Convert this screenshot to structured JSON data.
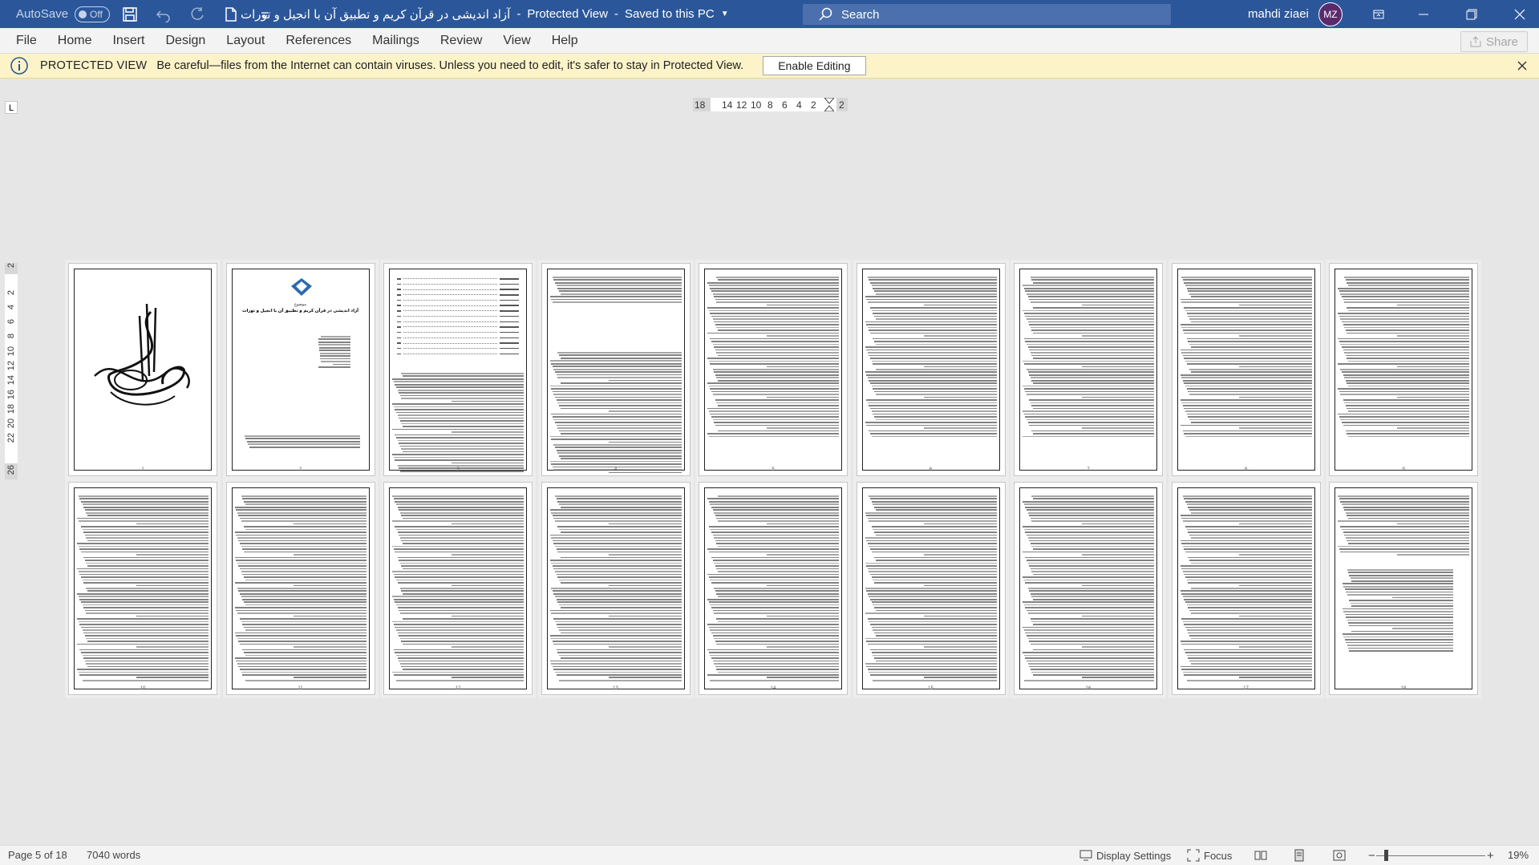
{
  "titlebar": {
    "autosave_label": "AutoSave",
    "autosave_state": "Off",
    "document_title": "آزاد اندیشی در قرآن کریم و تطبیق آن با انجیل و تورات",
    "separator": "-",
    "view_mode": "Protected View",
    "save_state": "Saved to this PC",
    "search_placeholder": "Search",
    "user_name": "mahdi ziaei",
    "user_initials": "MZ",
    "bg_color": "#2b579a"
  },
  "ribbon": {
    "tabs": [
      "File",
      "Home",
      "Insert",
      "Design",
      "Layout",
      "References",
      "Mailings",
      "Review",
      "View",
      "Help"
    ],
    "share_label": "Share"
  },
  "protected_view": {
    "title": "PROTECTED VIEW",
    "message": "Be careful—files from the Internet can contain viruses. Unless you need to edit, it's safer to stay in Protected View.",
    "button_label": "Enable Editing",
    "bg_color": "#fcf3c9"
  },
  "ruler": {
    "horizontal_ticks": [
      "18",
      "14",
      "12",
      "10",
      "8",
      "6",
      "4",
      "2",
      "2"
    ],
    "vertical_ticks": [
      "2",
      "2",
      "4",
      "6",
      "8",
      "10",
      "12",
      "14",
      "16",
      "18",
      "20",
      "22",
      "26"
    ],
    "tab_selector": "L"
  },
  "pages": {
    "row1": [
      {
        "kind": "calligraphy",
        "page_number": "1"
      },
      {
        "kind": "cover",
        "page_number": "2",
        "heading": "موضوع",
        "title": "آزاد اندیشی در قرآن کریم و تطبیق آن با انجیل و تورات"
      },
      {
        "kind": "toc",
        "page_number": "3"
      },
      {
        "kind": "text-short",
        "page_number": "4"
      },
      {
        "kind": "text",
        "page_number": "5"
      },
      {
        "kind": "text",
        "page_number": "6"
      },
      {
        "kind": "text",
        "page_number": "7"
      },
      {
        "kind": "text",
        "page_number": "8"
      },
      {
        "kind": "text",
        "page_number": "9"
      }
    ],
    "row2": [
      {
        "kind": "text-full",
        "page_number": "10"
      },
      {
        "kind": "text-full",
        "page_number": "11"
      },
      {
        "kind": "text-full",
        "page_number": "12"
      },
      {
        "kind": "text-full",
        "page_number": "13"
      },
      {
        "kind": "text-full",
        "page_number": "14"
      },
      {
        "kind": "text-full",
        "page_number": "15"
      },
      {
        "kind": "text-full",
        "page_number": "16"
      },
      {
        "kind": "text-full",
        "page_number": "17"
      },
      {
        "kind": "references",
        "page_number": "18"
      }
    ]
  },
  "status": {
    "page_info": "Page 5 of 18",
    "word_count": "7040 words",
    "display_settings": "Display Settings",
    "focus": "Focus",
    "zoom_minus": "−",
    "zoom_plus": "+",
    "zoom_level": "19%"
  }
}
